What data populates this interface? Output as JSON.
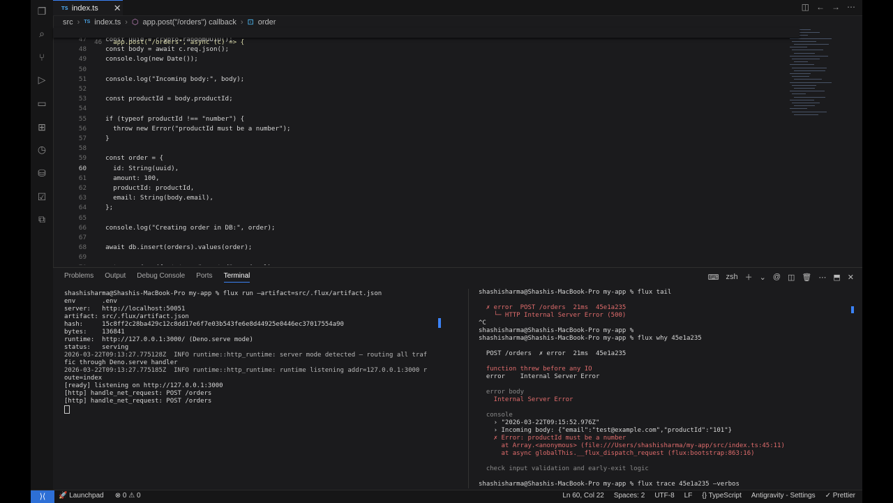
{
  "tab": {
    "lang": "TS",
    "name": "index.ts",
    "close": "✕"
  },
  "breadcrumb": {
    "root": "src",
    "file": "index.ts",
    "fn": "app.post(\"/orders\") callback",
    "sym": "order"
  },
  "sticky": {
    "num": "46",
    "text": "app.post(\"/orders\", async (c) => {"
  },
  "code_lines": [
    {
      "n": "47",
      "t": "  const uuid = crypto.randomUUID();"
    },
    {
      "n": "48",
      "t": "  const body = await c.req.json();"
    },
    {
      "n": "49",
      "t": "  console.log(new Date());"
    },
    {
      "n": "50",
      "t": ""
    },
    {
      "n": "51",
      "t": "  console.log(\"Incoming body:\", body);"
    },
    {
      "n": "52",
      "t": ""
    },
    {
      "n": "53",
      "t": "  const productId = body.productId;"
    },
    {
      "n": "54",
      "t": ""
    },
    {
      "n": "55",
      "t": "  if (typeof productId !== \"number\") {"
    },
    {
      "n": "56",
      "t": "    throw new Error(\"productId must be a number\");"
    },
    {
      "n": "57",
      "t": "  }"
    },
    {
      "n": "58",
      "t": ""
    },
    {
      "n": "59",
      "t": "  const order = {"
    },
    {
      "n": "60",
      "t": "    id: String(uuid),"
    },
    {
      "n": "61",
      "t": "    amount: 100,"
    },
    {
      "n": "62",
      "t": "    productId: productId,"
    },
    {
      "n": "63",
      "t": "    email: String(body.email),"
    },
    {
      "n": "64",
      "t": "  };"
    },
    {
      "n": "65",
      "t": ""
    },
    {
      "n": "66",
      "t": "  console.log(\"Creating order in DB:\", order);"
    },
    {
      "n": "67",
      "t": ""
    },
    {
      "n": "68",
      "t": "  await db.insert(orders).values(order);"
    },
    {
      "n": "69",
      "t": ""
    },
    {
      "n": "70",
      "t": "  return c.json({ status: \"created\", order });"
    }
  ],
  "panel_tabs": [
    "Problems",
    "Output",
    "Debug Console",
    "Ports",
    "Terminal"
  ],
  "shell": "zsh",
  "term_left": [
    "shashisharma@Shashis-MacBook-Pro my-app % flux run —artifact=src/.flux/artifact.json",
    "env       .env",
    "server:   http://localhost:50051",
    "artifact: src/.flux/artifact.json",
    "hash:     15c8ff2c28ba429c12c8dd17e6f7e03b543fe6e8d44925e0446ec37017554a90",
    "bytes:    136841",
    "runtime:  http://127.0.0.1:3000/ (Deno.serve mode)",
    "status:   serving",
    "2026-03-22T09:13:27.775128Z  INFO runtime::http_runtime: server mode detected — routing all traf",
    "fic through Deno.serve handler",
    "2026-03-22T09:13:27.775185Z  INFO runtime::http_runtime: runtime listening addr=127.0.0.1:3000 r",
    "oute=index",
    "[ready] listening on http://127.0.0.1:3000",
    "[http] handle_net_request: POST /orders",
    "[http] handle_net_request: POST /orders"
  ],
  "term_right": [
    {
      "t": "shashisharma@Shashis-MacBook-Pro my-app % flux tail",
      "c": ""
    },
    {
      "t": "",
      "c": ""
    },
    {
      "t": "  ✗ error  POST /orders  21ms  45e1a235",
      "c": "red"
    },
    {
      "t": "    └─ HTTP Internal Server Error (500)",
      "c": "red"
    },
    {
      "t": "^C",
      "c": ""
    },
    {
      "t": "shashisharma@Shashis-MacBook-Pro my-app %",
      "c": ""
    },
    {
      "t": "shashisharma@Shashis-MacBook-Pro my-app % flux why 45e1a235",
      "c": ""
    },
    {
      "t": "",
      "c": ""
    },
    {
      "t": "  POST /orders  ✗ error  21ms  45e1a235",
      "c": ""
    },
    {
      "t": "",
      "c": ""
    },
    {
      "t": "  function threw before any IO",
      "c": "red"
    },
    {
      "t": "  error    Internal Server Error",
      "c": ""
    },
    {
      "t": "",
      "c": ""
    },
    {
      "t": "  error body",
      "c": "gray"
    },
    {
      "t": "    Internal Server Error",
      "c": "red"
    },
    {
      "t": "",
      "c": ""
    },
    {
      "t": "  console",
      "c": "gray"
    },
    {
      "t": "    › \"2026-03-22T09:15:52.976Z\"",
      "c": ""
    },
    {
      "t": "    › Incoming body: {\"email\":\"test@example.com\",\"productId\":\"101\"}",
      "c": ""
    },
    {
      "t": "    ✗ Error: productId must be a number",
      "c": "red"
    },
    {
      "t": "      at Array.<anonymous> (file:///Users/shashisharma/my-app/src/index.ts:45:11)",
      "c": "red"
    },
    {
      "t": "      at async globalThis.__flux_dispatch_request (flux:bootstrap:863:16)",
      "c": "red"
    },
    {
      "t": "",
      "c": ""
    },
    {
      "t": "  check input validation and early-exit logic",
      "c": "gray"
    },
    {
      "t": "",
      "c": ""
    },
    {
      "t": "shashisharma@Shashis-MacBook-Pro my-app % flux trace 45e1a235 —verbos",
      "c": ""
    }
  ],
  "status": {
    "remote": "⟩⟨",
    "launchpad": "Launchpad",
    "errors": "0",
    "warnings": "0",
    "ln_col": "Ln 60, Col 22",
    "spaces": "Spaces: 2",
    "encoding": "UTF-8",
    "eol": "LF",
    "lang": "TypeScript",
    "profile": "Antigravity - Settings",
    "formatter": "Prettier"
  }
}
